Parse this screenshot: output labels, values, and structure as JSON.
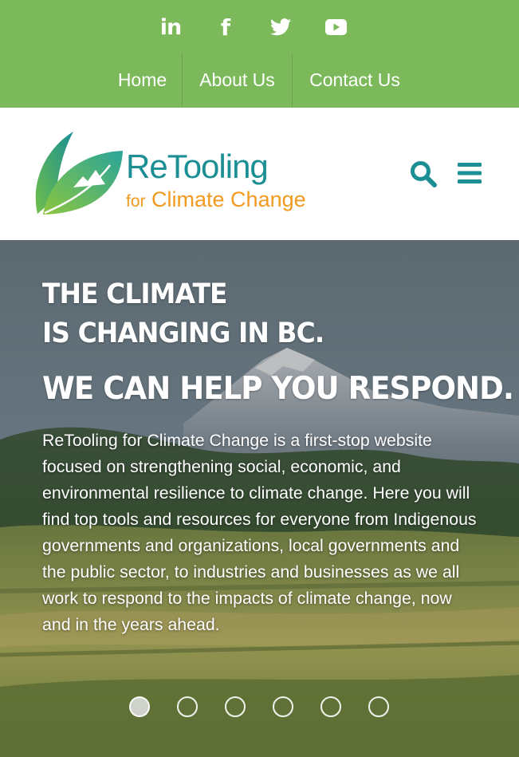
{
  "social": {
    "icons": [
      "linkedin-icon",
      "facebook-icon",
      "twitter-icon",
      "youtube-icon"
    ],
    "linkedin": "in",
    "facebook": "f"
  },
  "nav": {
    "items": [
      {
        "label": "Home"
      },
      {
        "label": "About Us"
      },
      {
        "label": "Contact Us"
      }
    ]
  },
  "logo": {
    "title": "ReTooling",
    "sub_small": "for",
    "sub_main": "Climate Change"
  },
  "header": {
    "icons": [
      "search-icon",
      "menu-icon"
    ]
  },
  "hero": {
    "line1": "THE CLIMATE",
    "line2": "IS CHANGING IN BC.",
    "line3": "WE CAN HELP YOU RESPOND.",
    "description": "ReTooling for Climate Change is a first-stop website focused on strengthening social, economic, and environmental resilience to climate change. Here you will find top tools and resources for everyone from Indigenous governments and organizations, local governments and the public sector, to industries and businesses as we all work to respond to the impacts of climate change, now and in the years ahead.",
    "slides": 6,
    "active_slide": 1
  },
  "colors": {
    "topbar": "#7cb95b",
    "teal": "#1b8f94",
    "orange": "#f29a1f"
  }
}
